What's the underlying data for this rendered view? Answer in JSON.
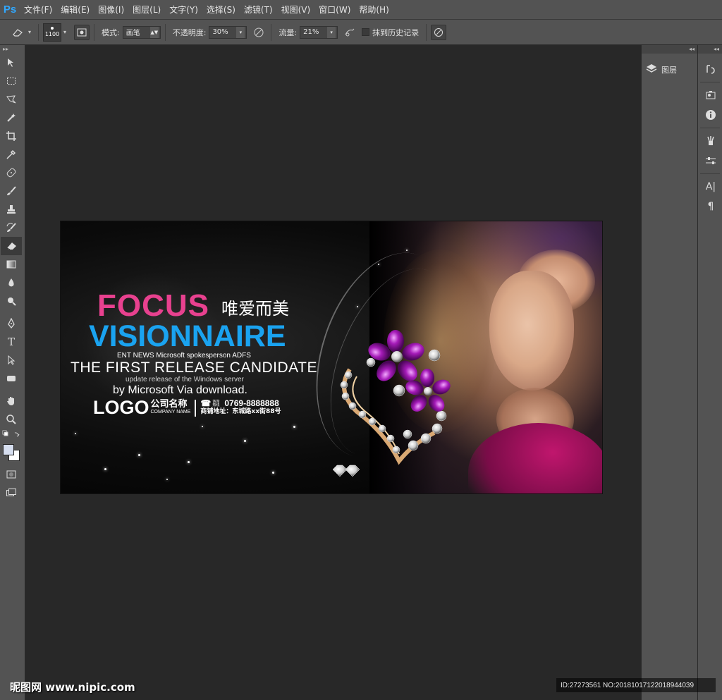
{
  "app": {
    "logo": "Ps"
  },
  "menu": [
    "文件(F)",
    "编辑(E)",
    "图像(I)",
    "图层(L)",
    "文字(Y)",
    "选择(S)",
    "滤镜(T)",
    "视图(V)",
    "窗口(W)",
    "帮助(H)"
  ],
  "options": {
    "brush_size": "1100",
    "mode_label": "模式:",
    "mode_value": "画笔",
    "opacity_label": "不透明度:",
    "opacity_value": "30%",
    "flow_label": "流量:",
    "flow_value": "21%",
    "erase_history_label": "抹到历史记录",
    "erase_history_checked": false
  },
  "panels": {
    "layers_label": "图层"
  },
  "artwork": {
    "focus": "FOCUS",
    "cn_tagline": "唯爱而美",
    "visionnaire": "VISIONNAIRE",
    "ent_news": "ENT NEWS Microsoft spokesperson ADFS",
    "first_release": "THE FIRST RELEASE CANDIDATE",
    "update": "update release of the Windows server",
    "by_line": "by Microsoft Via download.",
    "logo": "LOGO",
    "company_cn": "公司名称",
    "company_en": "COMPANY NAME",
    "hotline_tiny": "咨询热线",
    "phone": "0769-8888888",
    "address": "商铺地址：东城路xx街88号",
    "colors": {
      "focus": "#e8418f",
      "visionnaire": "#1aa3f0",
      "dress": "#c0166d"
    }
  },
  "watermark": {
    "left": "昵图网 www.nipic.com",
    "right": "ID:27273561 NO:20181017122018944039"
  }
}
